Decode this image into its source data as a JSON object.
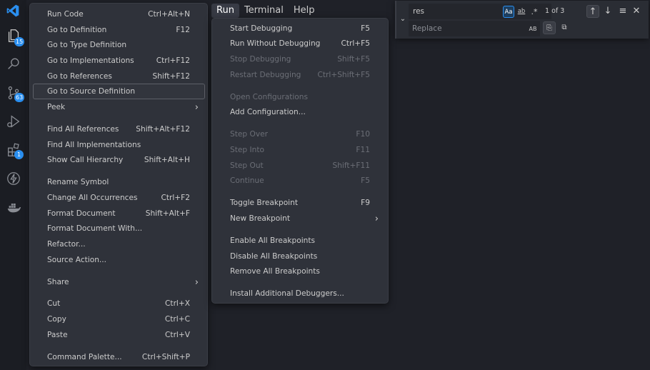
{
  "activity_bar": {
    "badges": {
      "explorer": "15",
      "source_control": "63",
      "extensions": "1"
    }
  },
  "menubar": {
    "items": [
      {
        "label": "Run",
        "active": true
      },
      {
        "label": "Terminal",
        "active": false
      },
      {
        "label": "Help",
        "active": false
      }
    ]
  },
  "context_menu": {
    "items": [
      {
        "label": "Run Code",
        "shortcut": "Ctrl+Alt+N"
      },
      {
        "label": "Go to Definition",
        "shortcut": "F12"
      },
      {
        "label": "Go to Type Definition",
        "shortcut": ""
      },
      {
        "label": "Go to Implementations",
        "shortcut": "Ctrl+F12"
      },
      {
        "label": "Go to References",
        "shortcut": "Shift+F12"
      },
      {
        "label": "Go to Source Definition",
        "shortcut": ""
      },
      {
        "label": "Peek",
        "shortcut": ""
      },
      {
        "label": "Find All References",
        "shortcut": "Shift+Alt+F12"
      },
      {
        "label": "Find All Implementations",
        "shortcut": ""
      },
      {
        "label": "Show Call Hierarchy",
        "shortcut": "Shift+Alt+H"
      },
      {
        "label": "Rename Symbol",
        "shortcut": ""
      },
      {
        "label": "Change All Occurrences",
        "shortcut": "Ctrl+F2"
      },
      {
        "label": "Format Document",
        "shortcut": "Shift+Alt+F"
      },
      {
        "label": "Format Document With...",
        "shortcut": ""
      },
      {
        "label": "Refactor...",
        "shortcut": ""
      },
      {
        "label": "Source Action...",
        "shortcut": ""
      },
      {
        "label": "Share",
        "shortcut": ""
      },
      {
        "label": "Cut",
        "shortcut": "Ctrl+X"
      },
      {
        "label": "Copy",
        "shortcut": "Ctrl+C"
      },
      {
        "label": "Paste",
        "shortcut": "Ctrl+V"
      },
      {
        "label": "Command Palette...",
        "shortcut": "Ctrl+Shift+P"
      }
    ]
  },
  "run_menu": {
    "items": [
      {
        "label": "Start Debugging",
        "shortcut": "F5"
      },
      {
        "label": "Run Without Debugging",
        "shortcut": "Ctrl+F5"
      },
      {
        "label": "Stop Debugging",
        "shortcut": "Shift+F5"
      },
      {
        "label": "Restart Debugging",
        "shortcut": "Ctrl+Shift+F5"
      },
      {
        "label": "Open Configurations",
        "shortcut": ""
      },
      {
        "label": "Add Configuration...",
        "shortcut": ""
      },
      {
        "label": "Step Over",
        "shortcut": "F10"
      },
      {
        "label": "Step Into",
        "shortcut": "F11"
      },
      {
        "label": "Step Out",
        "shortcut": "Shift+F11"
      },
      {
        "label": "Continue",
        "shortcut": "F5"
      },
      {
        "label": "Toggle Breakpoint",
        "shortcut": "F9"
      },
      {
        "label": "New Breakpoint",
        "shortcut": ""
      },
      {
        "label": "Enable All Breakpoints",
        "shortcut": ""
      },
      {
        "label": "Disable All Breakpoints",
        "shortcut": ""
      },
      {
        "label": "Remove All Breakpoints",
        "shortcut": ""
      },
      {
        "label": "Install Additional Debuggers...",
        "shortcut": ""
      }
    ]
  },
  "find_widget": {
    "search_value": "res",
    "replace_placeholder": "Replace",
    "match_case_label": "Aa",
    "whole_word_label": "ab",
    "regex_label": ".*",
    "preserve_case_label": "AB",
    "count": "1 of 3"
  },
  "colors": {
    "accent": "#2a8ff0",
    "menu_bg": "#2f323a",
    "editor_bg": "#1f2128"
  }
}
